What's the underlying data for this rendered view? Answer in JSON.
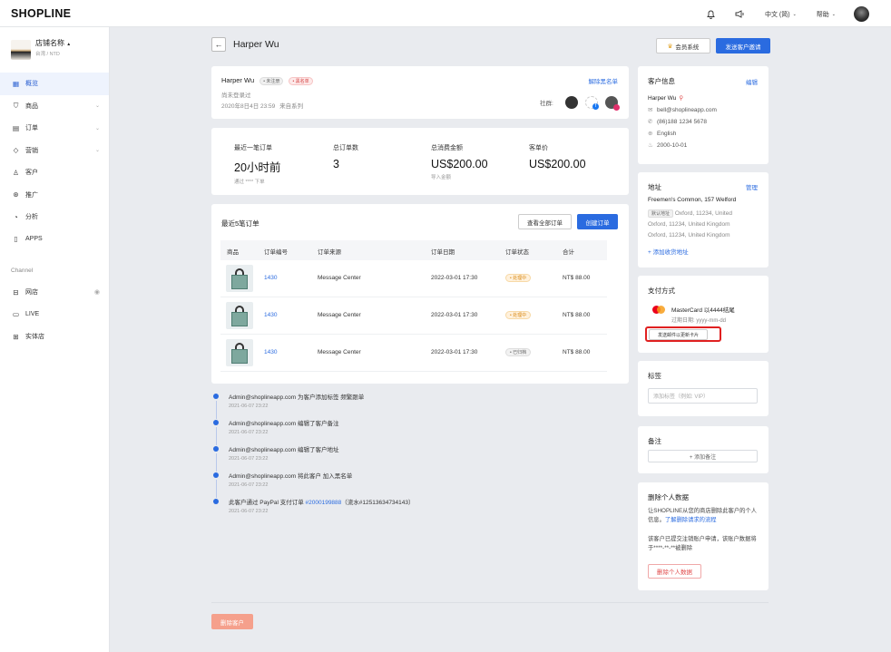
{
  "topbar": {
    "logo": "SHOPLINE",
    "lang_label": "中文 (简)",
    "help_label": "帮助",
    "bell_icon": "bell-icon",
    "announce_icon": "megaphone-icon"
  },
  "sidebar": {
    "store_name": "店铺名称",
    "store_sub": "台湾 / NTD",
    "items": [
      {
        "icon": "▦",
        "label": "概览",
        "active": true,
        "chevron": false
      },
      {
        "icon": "⛉",
        "label": "商品",
        "active": false,
        "chevron": true
      },
      {
        "icon": "▤",
        "label": "订单",
        "active": false,
        "chevron": true
      },
      {
        "icon": "◇",
        "label": "营销",
        "active": false,
        "chevron": true
      },
      {
        "icon": "♙",
        "label": "客户",
        "active": false,
        "chevron": false
      },
      {
        "icon": "⊛",
        "label": "推广",
        "active": false,
        "chevron": false
      },
      {
        "icon": "◔",
        "label": "分析",
        "active": false,
        "chevron": false
      },
      {
        "icon": "▯",
        "label": "APPS",
        "active": false,
        "chevron": false
      }
    ],
    "channel_title": "Channel",
    "channels": [
      {
        "icon": "⊟",
        "label": "网店"
      },
      {
        "icon": "▭",
        "label": "LIVE"
      },
      {
        "icon": "⊞",
        "label": "实体店"
      }
    ]
  },
  "header": {
    "title": "Harper Wu",
    "member_btn": "会员系统",
    "invite_btn": "发送客户邀请"
  },
  "profile": {
    "name": "Harper Wu",
    "tag1": "• 未注册",
    "tag2": "• 黑名单",
    "unblacklist": "解除黑名单",
    "login_status": "尚未登录过",
    "created": "2020年8日4日 23:59",
    "source": "来自系列",
    "social_label": "社群:"
  },
  "stats": [
    {
      "label": "最近一笔订单",
      "value": "20小时前",
      "sub": "通过 **** 下单",
      "label_link": true
    },
    {
      "label": "总订单数",
      "value": "3",
      "sub": "",
      "label_link": false
    },
    {
      "label": "总消费金额",
      "value": "US$200.00",
      "sub": "导入金额",
      "label_link": false
    },
    {
      "label": "客单价",
      "value": "US$200.00",
      "sub": "",
      "label_link": false
    }
  ],
  "orders": {
    "title": "最近5笔订单",
    "view_all": "查看全部订单",
    "create": "创建订单",
    "columns": [
      "商品",
      "订单编号",
      "订单来源",
      "订单日期",
      "订单状态",
      "合计"
    ],
    "rows": [
      {
        "id": "1430",
        "source": "Message Center",
        "date": "2022-03-01 17:30",
        "status": "• 处理中",
        "status_type": "orange",
        "total": "NT$ 88.00"
      },
      {
        "id": "1430",
        "source": "Message Center",
        "date": "2022-03-01 17:30",
        "status": "• 处理中",
        "status_type": "orange",
        "total": "NT$ 88.00"
      },
      {
        "id": "1430",
        "source": "Message Center",
        "date": "2022-03-01 17:30",
        "status": "• 已归档",
        "status_type": "gray",
        "total": "NT$ 88.00"
      }
    ]
  },
  "timeline": [
    {
      "text": "Admin@shoplineapp.com 为客户添加标签 频繁跟单",
      "time": "2021-06-07 23:22"
    },
    {
      "text": "Admin@shoplineapp.com 编辑了客户备注",
      "time": "2021-06-07 23:22"
    },
    {
      "text": "Admin@shoplineapp.com 编辑了客户地址",
      "time": "2021-06-07 23:22"
    },
    {
      "text": "Admin@shoplineapp.com 将此客户 加入黑名单",
      "time": "2021-06-07 23:22"
    },
    {
      "text_pre": "此客户通过 PayPal 支付订单 ",
      "text_link": "#2000199888",
      "text_post": "（流水#12513634734143）",
      "time": "2021-06-07 23:22"
    }
  ],
  "delete_customer_btn": "删除客户",
  "customer_info": {
    "title": "客户信息",
    "edit": "编辑",
    "name": "Harper Wu",
    "email": "bell@shoplineapp.com",
    "phone": "(86)188 1234 5678",
    "language": "English",
    "birthday": "2000-10-01"
  },
  "address": {
    "title": "地址",
    "manage": "管理",
    "name": "Freemen's Common, 157 Welford",
    "default_tag": "默认地址",
    "line1": "Oxford, 11234, United",
    "line2": "Oxford, 11234, United Kingdom",
    "line3": "Oxford, 11234, United Kingdom",
    "add": "+ 添加收货地址"
  },
  "payment": {
    "title": "支付方式",
    "card": "MasterCard 以4444结尾",
    "expiry": "过期日期: yyyy-mm-dd",
    "send_btn": "发送邮件以更新卡片"
  },
  "tags": {
    "title": "标签",
    "placeholder": "添加标签（例如: VIP）"
  },
  "notes": {
    "title": "备注",
    "add": "+ 添加备注"
  },
  "delete_data": {
    "title": "删除个人数据",
    "desc1": "让SHOPLINE从您的商店删除此客户的个人信息。",
    "desc_link": "了解删除请求的流程",
    "desc2": "该客户已提交注销账户申请，该账户数据将于****-**-**被删除",
    "btn": "删除个人数据"
  },
  "colors": {
    "primary": "#2a6be0",
    "danger": "#e04848",
    "highlight_box": "#e02020"
  }
}
